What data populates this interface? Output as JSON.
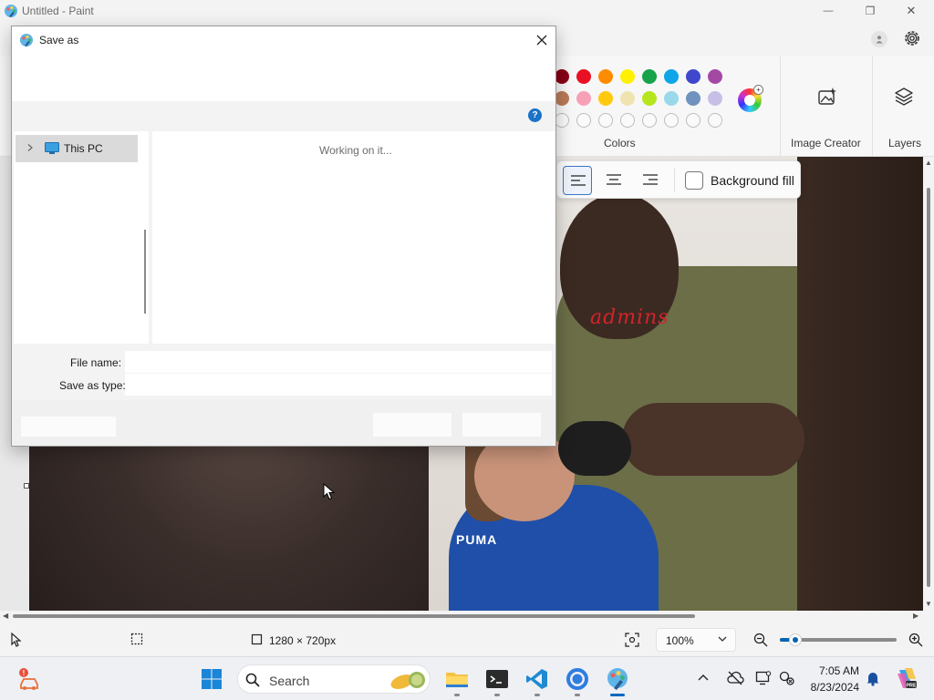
{
  "window": {
    "title": "Untitled - Paint",
    "minimize_glyph": "—",
    "restore_glyph": "❐",
    "close_glyph": "✕"
  },
  "ribbon": {
    "colors_label": "Colors",
    "image_creator_label": "Image Creator",
    "layers_label": "Layers",
    "swatch_rows": [
      [
        "#880015",
        "#e81123",
        "#ff8c00",
        "#fff100",
        "#16a34a",
        "#0ea5e9",
        "#3f48cc",
        "#a349a4"
      ],
      [
        "#b97a57",
        "#f7a1b7",
        "#ffc90e",
        "#efe4b0",
        "#b5e61d",
        "#99d9ea",
        "#7092be",
        "#c8bfe7"
      ],
      [
        "",
        "",
        "",
        "",
        "",
        "",
        "",
        ""
      ]
    ]
  },
  "text_toolbar": {
    "background_fill_label": "Background fill",
    "alignment_selected": "left"
  },
  "canvas": {
    "watermark": "admins",
    "shirt_brand": "PUMA"
  },
  "statusbar": {
    "canvas_size": "1280 × 720px",
    "zoom": "100%",
    "zoom_slider_fraction": 0.13
  },
  "dialog": {
    "title": "Save as",
    "nav_item": "This PC",
    "status": "Working on it...",
    "file_name_label": "File name:",
    "save_as_type_label": "Save as type:",
    "file_name_value": "",
    "save_as_type_value": "",
    "help_glyph": "?"
  },
  "taskbar": {
    "search_placeholder": "Search",
    "time": "7:05 AM",
    "date": "8/23/2024",
    "apps": [
      "file-explorer",
      "terminal",
      "vs-code",
      "chrome",
      "paint"
    ]
  },
  "colors": {
    "accent": "#0067c0",
    "watermark": "#d4232b",
    "shirt_blue": "#1f4fa8",
    "shirt_olive": "#6b6e47"
  }
}
